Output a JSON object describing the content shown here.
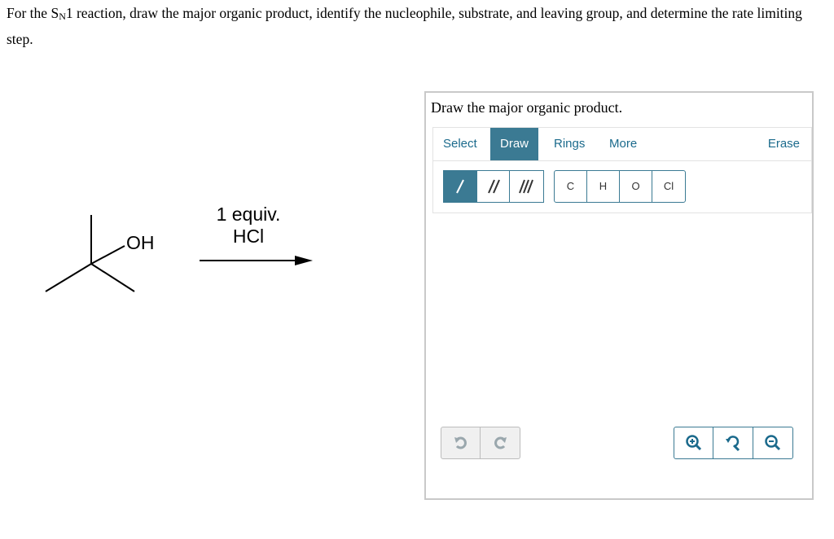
{
  "question": {
    "prefix": "For the S",
    "subscript": "N",
    "suffix": "1 reaction, draw the major organic product, identify the nucleophile, substrate, and leaving group, and determine the rate limiting step."
  },
  "reaction": {
    "substituent": "OH",
    "reagent_line1": "1 equiv.",
    "reagent_line2": "HCl"
  },
  "panel": {
    "title": "Draw the major organic product.",
    "tabs": {
      "select": "Select",
      "draw": "Draw",
      "rings": "Rings",
      "more": "More",
      "erase": "Erase"
    },
    "active_tab": "Draw",
    "bond_tools": [
      "single-bond",
      "double-bond",
      "triple-bond"
    ],
    "atoms": [
      "C",
      "H",
      "O",
      "Cl"
    ],
    "undo_icon": "undo-icon",
    "redo_icon": "redo-icon",
    "zoom_icons": [
      "zoom-in-icon",
      "reset-zoom-icon",
      "zoom-out-icon"
    ]
  },
  "colors": {
    "accent": "#3b7a93",
    "link": "#1b6a8c",
    "panel_border": "#c9c9c9"
  }
}
